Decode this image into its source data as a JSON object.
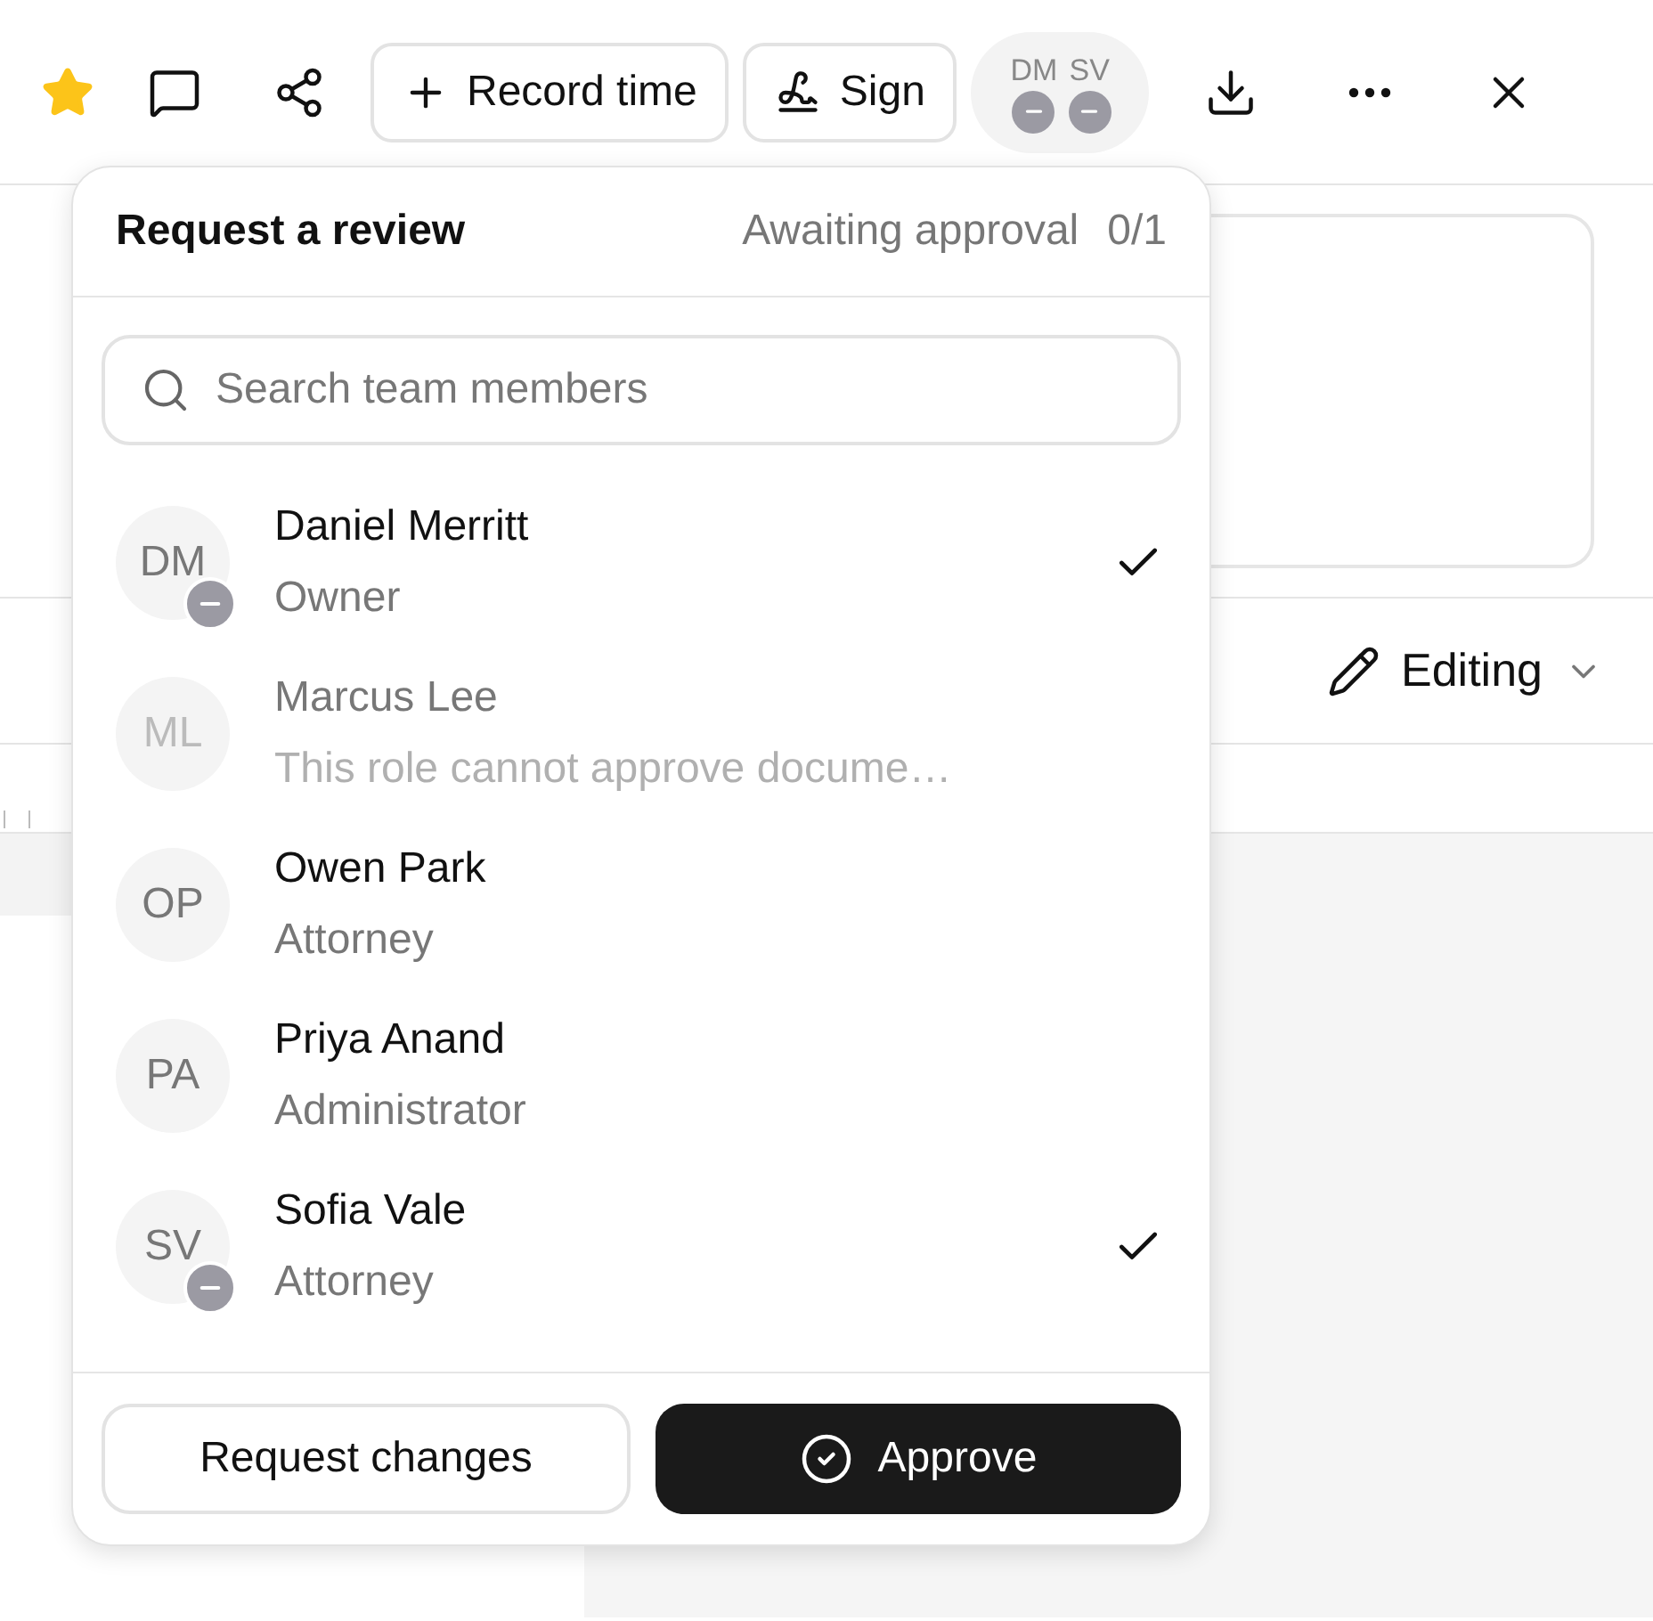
{
  "toolbar": {
    "starred": true,
    "buttons": [
      {
        "kind": "record",
        "label": "Record time"
      },
      {
        "kind": "sign",
        "label": "Sign"
      }
    ],
    "avatars": [
      {
        "initials": "DM",
        "away": true
      },
      {
        "initials": "SV",
        "away": true
      }
    ]
  },
  "document": {
    "mode": "Editing"
  },
  "review_popover": {
    "title": "Request a review",
    "status": "Awaiting approval",
    "count": "0/1",
    "search": {
      "placeholder": "Search team members"
    },
    "members": [
      {
        "initials": "DM",
        "name": "Daniel Merritt",
        "role": "Owner",
        "away": true,
        "selected": true,
        "disabled": false
      },
      {
        "initials": "ML",
        "name": "Marcus Lee",
        "role": "This role cannot approve docume…",
        "away": false,
        "selected": false,
        "disabled": true
      },
      {
        "initials": "OP",
        "name": "Owen Park",
        "role": "Attorney",
        "away": false,
        "selected": false,
        "disabled": false
      },
      {
        "initials": "PA",
        "name": "Priya Anand",
        "role": "Administrator",
        "away": false,
        "selected": false,
        "disabled": false
      },
      {
        "initials": "SV",
        "name": "Sofia Vale",
        "role": "Attorney",
        "away": true,
        "selected": true,
        "disabled": false
      }
    ],
    "secondary_button": "Request changes",
    "primary_button": "Approve"
  }
}
